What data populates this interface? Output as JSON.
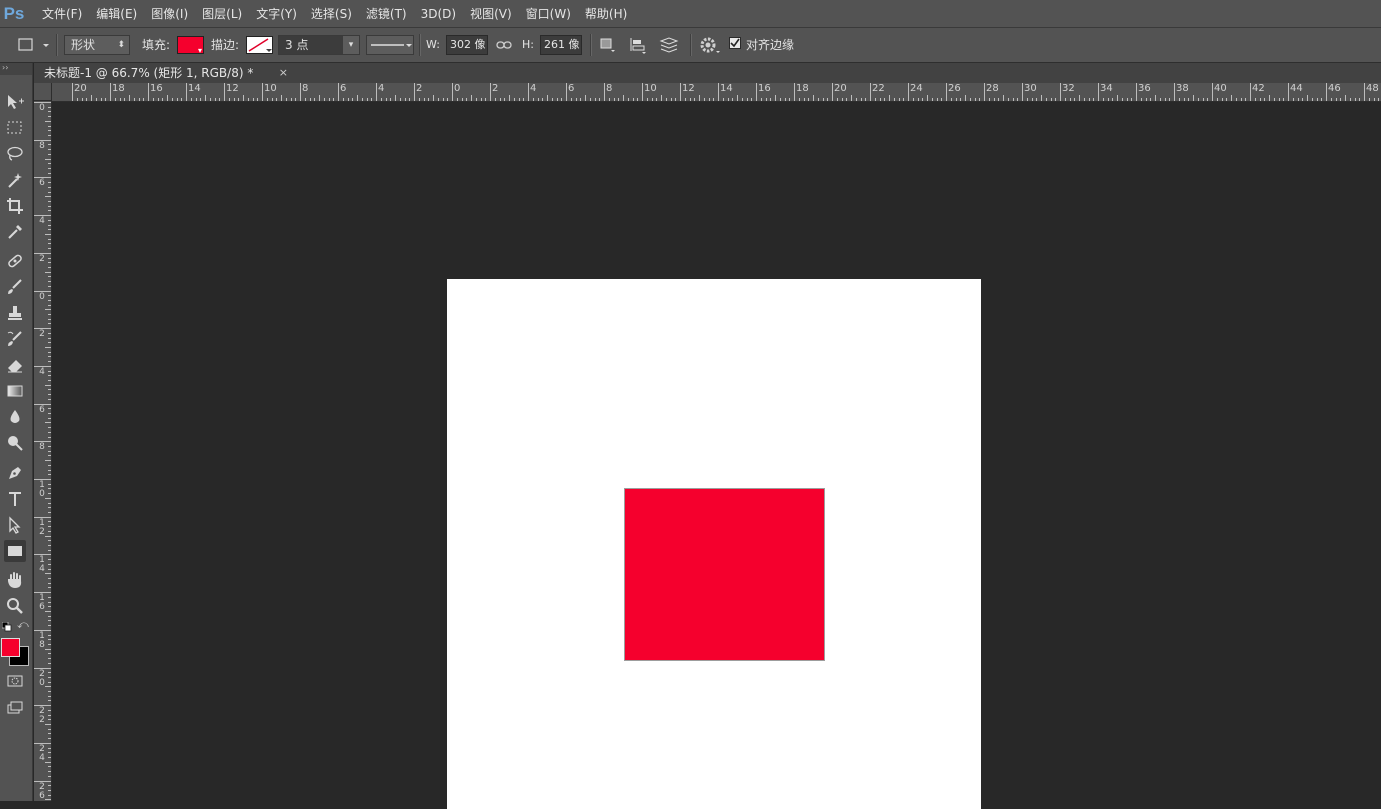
{
  "app": {
    "logo": "Ps"
  },
  "menu": [
    "文件(F)",
    "编辑(E)",
    "图像(I)",
    "图层(L)",
    "文字(Y)",
    "选择(S)",
    "滤镜(T)",
    "3D(D)",
    "视图(V)",
    "窗口(W)",
    "帮助(H)"
  ],
  "options": {
    "mode": "形状",
    "fill_label": "填充:",
    "fill_color": "#f5002d",
    "stroke_label": "描边:",
    "stroke_width": "3 点",
    "w_label": "W:",
    "w_value": "302 像",
    "h_label": "H:",
    "h_value": "261 像",
    "align_edges_label": "对齐边缘",
    "align_edges_checked": true
  },
  "document": {
    "tab_title": "未标题-1 @ 66.7% (矩形 1, RGB/8) *",
    "close_glyph": "×",
    "canvas_color": "#ffffff",
    "shape_color": "#f5002d"
  },
  "colors": {
    "foreground": "#f5002d",
    "background": "#000000",
    "accent_logo": "#6fa8dc"
  },
  "ruler_top_labels": [
    "20",
    "18",
    "16",
    "14",
    "12",
    "10",
    "8",
    "6",
    "4",
    "2",
    "0",
    "2",
    "4",
    "6",
    "8",
    "10",
    "12",
    "14",
    "16",
    "18",
    "20",
    "22",
    "24",
    "26",
    "28",
    "30",
    "32",
    "34",
    "36",
    "38",
    "40",
    "42",
    "44",
    "46",
    "48"
  ],
  "ruler_left_labels": [
    "0",
    "8",
    "6",
    "4",
    "2",
    "0",
    "2",
    "4",
    "6",
    "8",
    "10",
    "12",
    "14",
    "16",
    "18",
    "20",
    "22",
    "24",
    "26"
  ]
}
